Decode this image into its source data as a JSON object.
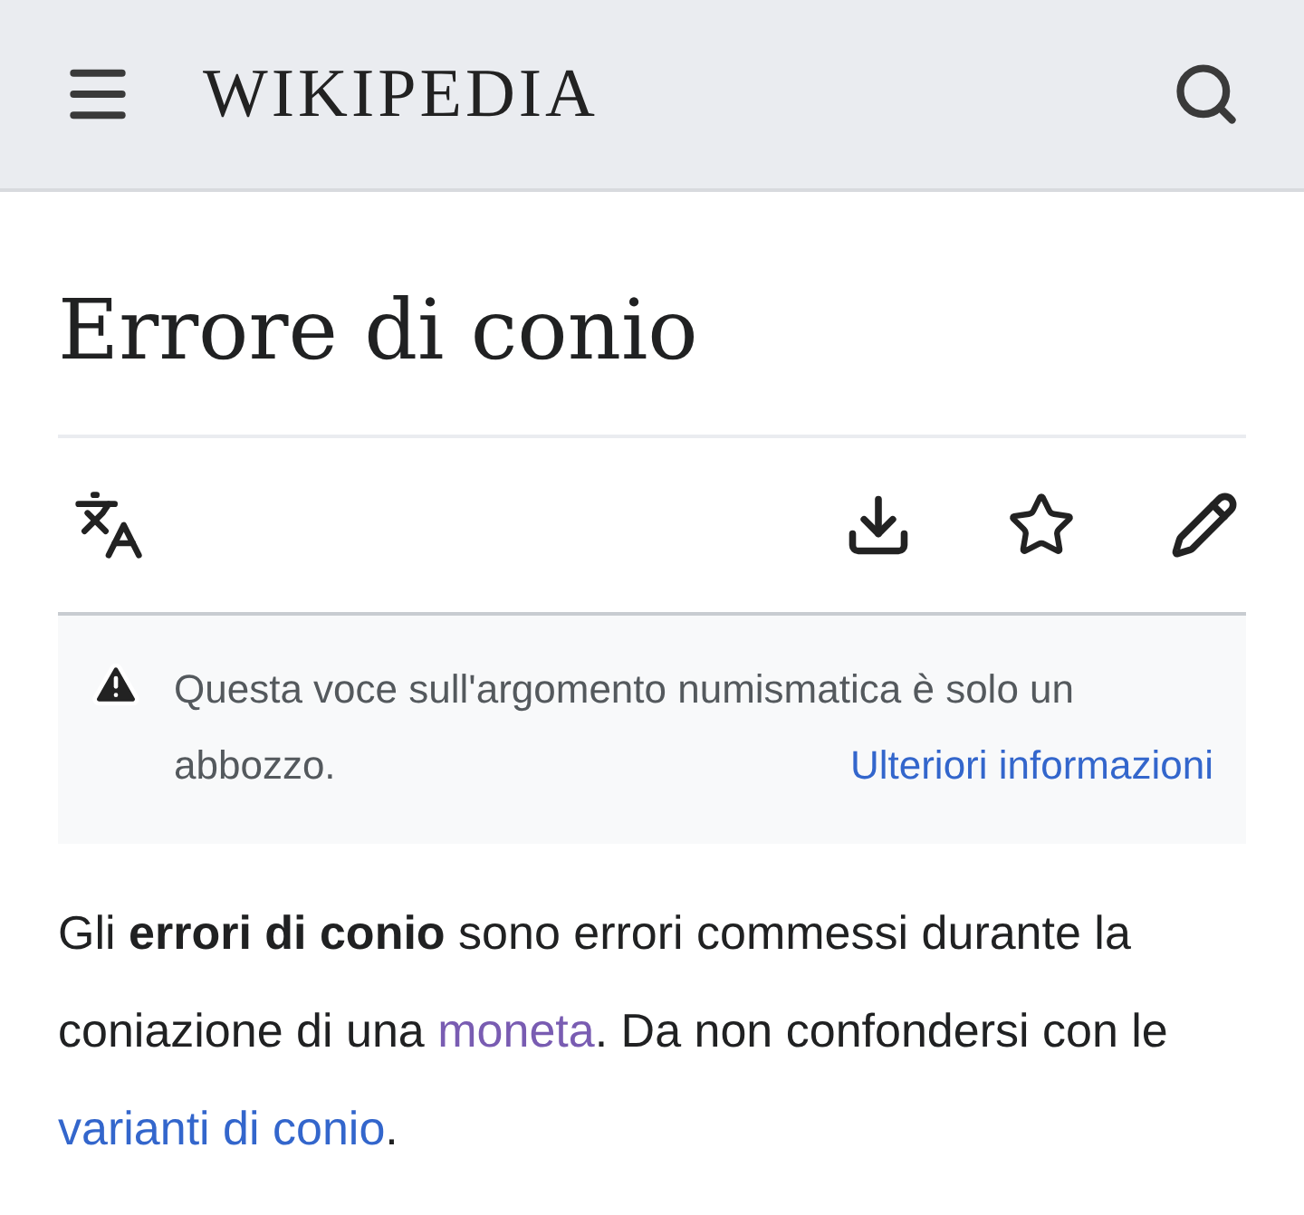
{
  "header": {
    "wordmark": "WIKIPEDIA"
  },
  "title": "Errore di conio",
  "notice": {
    "text": "Questa voce sull'argomento numismatica è solo un abbozzo.",
    "link": "Ulteriori informazioni"
  },
  "paragraph": [
    {
      "kind": "text",
      "text": "Gli "
    },
    {
      "kind": "bold",
      "text": "errori di conio"
    },
    {
      "kind": "text",
      "text": " sono errori commessi durante la coniazione di una "
    },
    {
      "kind": "link",
      "text": "moneta",
      "visited": true
    },
    {
      "kind": "text",
      "text": ". Da non confondersi con le "
    },
    {
      "kind": "link",
      "text": "varianti di conio",
      "visited": false
    },
    {
      "kind": "text",
      "text": "."
    }
  ]
}
